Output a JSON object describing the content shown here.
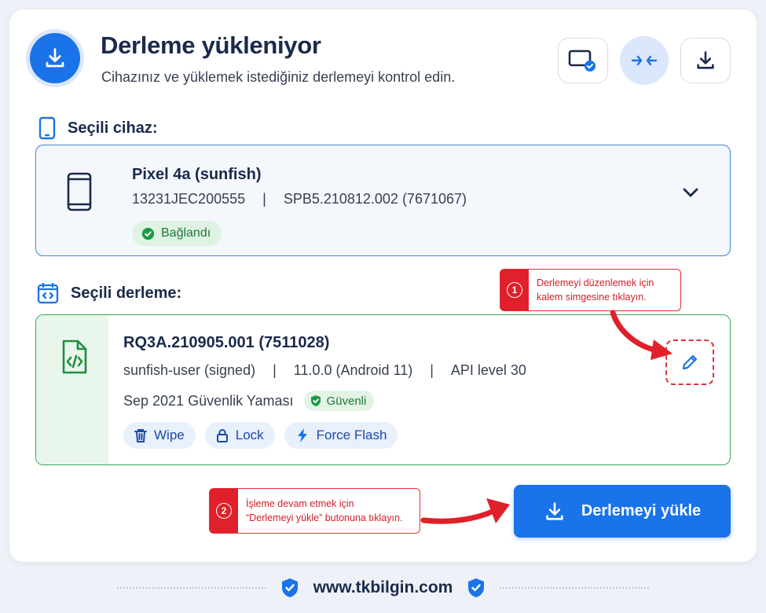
{
  "header": {
    "title": "Derleme yükleniyor",
    "subtitle": "Cihazınız ve yüklemek istediğiniz derlemeyi kontrol edin.",
    "icon": "download-icon",
    "toolbar": [
      "device-check-icon",
      "compress-arrows-icon",
      "download-icon"
    ]
  },
  "device_section": {
    "label": "Seçili cihaz:",
    "name": "Pixel 4a (sunfish)",
    "serial": "13231JEC200555",
    "separator": "|",
    "build_id": "SPB5.210812.002 (7671067)",
    "status": "Bağlandı"
  },
  "build_section": {
    "label": "Seçili derleme:",
    "name": "RQ3A.210905.001 (7511028)",
    "variant": "sunfish-user (signed)",
    "version": "11.0.0 (Android 11)",
    "api": "API level 30",
    "separator": "|",
    "patch": "Sep 2021 Güvenlik Yaması",
    "safe_badge": "Güvenli",
    "chips": [
      "Wipe",
      "Lock",
      "Force Flash"
    ]
  },
  "callouts": {
    "one_num": "1",
    "one_line1": "Derlemeyi düzenlemek için",
    "one_line2": "kalem simgesine tıklayın.",
    "two_num": "2",
    "two_line1": "İşleme devam etmek için",
    "two_line2": "“Derlemeyi yükle” butonuna tıklayın."
  },
  "primary_button": "Derlemeyi yükle",
  "footer": "www.tkbilgin.com",
  "colors": {
    "accent": "#1a73e8",
    "success": "#1e7a3a",
    "annotation": "#e0202a"
  }
}
